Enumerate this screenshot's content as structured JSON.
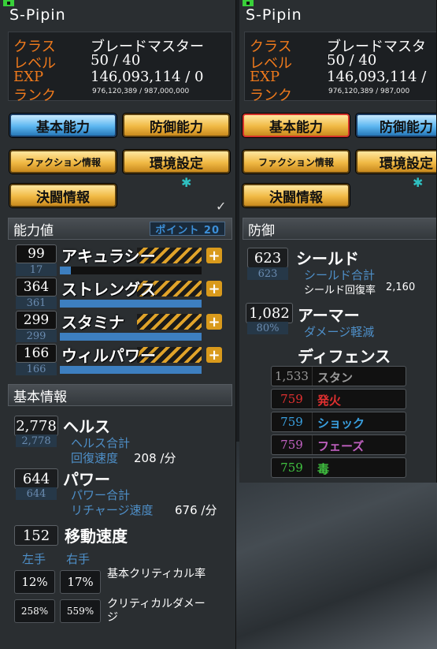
{
  "left_panel": {
    "title": "S-Pipin",
    "charinfo": {
      "class_label": "クラス",
      "class_value": "ブレードマスター",
      "level_label": "レベル",
      "level_value": "50 / 40",
      "exp_label": "EXP",
      "exp_value": "146,093,114 / 0",
      "rank_label": "ランク",
      "rank_value": "976,120,389 / 987,000,000"
    },
    "tabs": {
      "basic": "基本能力",
      "defense": "防御能力",
      "faction": "ファクション情報",
      "settings": "環境設定",
      "duel": "決闘情報"
    },
    "stats_section": "能力値",
    "points_label": "ポイント 20",
    "stats": [
      {
        "value": "99",
        "sub": "17",
        "name": "アキュラシー",
        "fill": 0.08
      },
      {
        "value": "364",
        "sub": "361",
        "name": "ストレングス",
        "fill": 1.0
      },
      {
        "value": "299",
        "sub": "299",
        "name": "スタミナ",
        "fill": 1.0
      },
      {
        "value": "166",
        "sub": "166",
        "name": "ウィルパワー",
        "fill": 1.0
      }
    ],
    "basic_section": "基本情報",
    "health": {
      "value": "2,778",
      "sub": "2,778",
      "name": "ヘルス",
      "total_label": "ヘルス合計",
      "regen_label": "回復速度",
      "regen_value": "208 /分"
    },
    "power": {
      "value": "644",
      "sub": "644",
      "name": "パワー",
      "total_label": "パワー合計",
      "recharge_label": "リチャージ速度",
      "recharge_value": "676 /分"
    },
    "move": {
      "value": "152",
      "name": "移動速度"
    },
    "hands": {
      "left": "左手",
      "right": "右手"
    },
    "crit": {
      "left": "12%",
      "right": "17%",
      "label": "基本クリティカル率"
    },
    "critdmg": {
      "left": "258%",
      "right": "559%",
      "label": "クリティカルダメージ"
    }
  },
  "right_panel": {
    "title": "S-Pipin",
    "charinfo": {
      "class_label": "クラス",
      "class_value": "ブレードマスタ",
      "level_label": "レベル",
      "level_value": "50 / 40",
      "exp_label": "EXP",
      "exp_value": "146,093,114 /",
      "rank_label": "ランク",
      "rank_value": "976,120,389 / 987,000"
    },
    "tabs": {
      "basic": "基本能力",
      "defense": "防御能力",
      "faction": "ファクション情報",
      "settings": "環境設定",
      "duel": "決闘情報"
    },
    "defense_section": "防御",
    "shield": {
      "value": "623",
      "sub": "623",
      "name": "シールド",
      "total_label": "シールド合計",
      "regen_label": "シールド回復率",
      "regen_value": "2,160"
    },
    "armor": {
      "value": "1,082",
      "sub": "80%",
      "name": "アーマー",
      "reduce_label": "ダメージ軽減"
    },
    "defence_header": "ディフェンス",
    "defences": [
      {
        "value": "1,533",
        "label": "スタン",
        "color": "#9a9a9a"
      },
      {
        "value": "759",
        "label": "発火",
        "color": "#e03030"
      },
      {
        "value": "759",
        "label": "ショック",
        "color": "#3aa0e0"
      },
      {
        "value": "759",
        "label": "フェーズ",
        "color": "#c060c0"
      },
      {
        "value": "759",
        "label": "毒",
        "color": "#40c040"
      }
    ]
  }
}
